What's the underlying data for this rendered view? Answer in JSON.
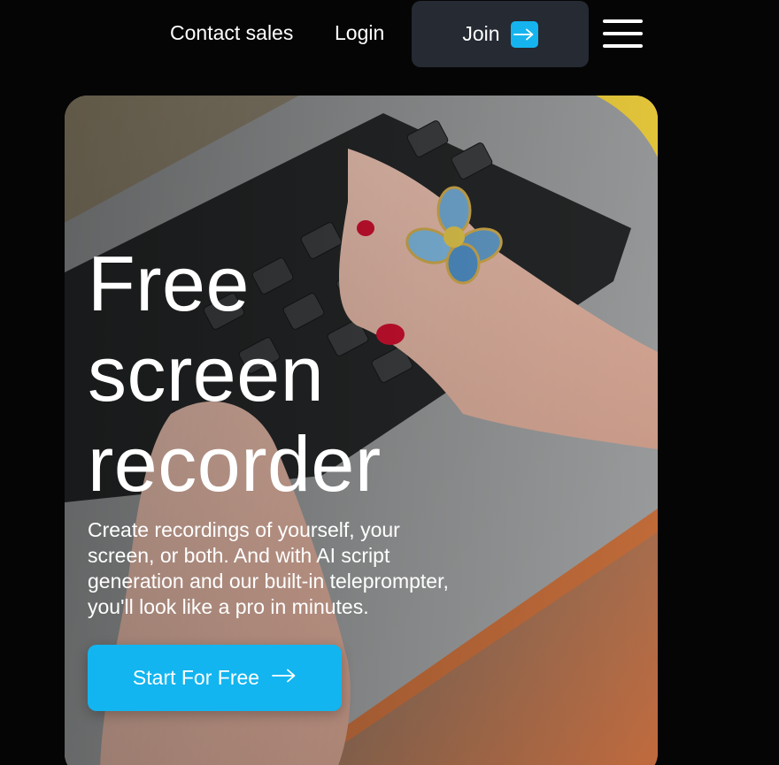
{
  "nav": {
    "contact_label": "Contact sales",
    "login_label": "Login",
    "join_label": "Join",
    "join_icon": "arrow-right-icon",
    "menu_icon": "hamburger-menu-icon"
  },
  "hero": {
    "title_line1": "Free",
    "title_line2": "screen",
    "title_line3": "recorder",
    "subtitle": "Create recordings of yourself, your screen, or both. And with AI script generation and our built-in teleprompter, you'll look like a pro in minutes.",
    "cta_label": "Start For Free",
    "cta_icon": "arrow-right-icon"
  },
  "colors": {
    "accent": "#12b5ef",
    "join_bg": "#252a33",
    "page_bg": "#050505"
  }
}
